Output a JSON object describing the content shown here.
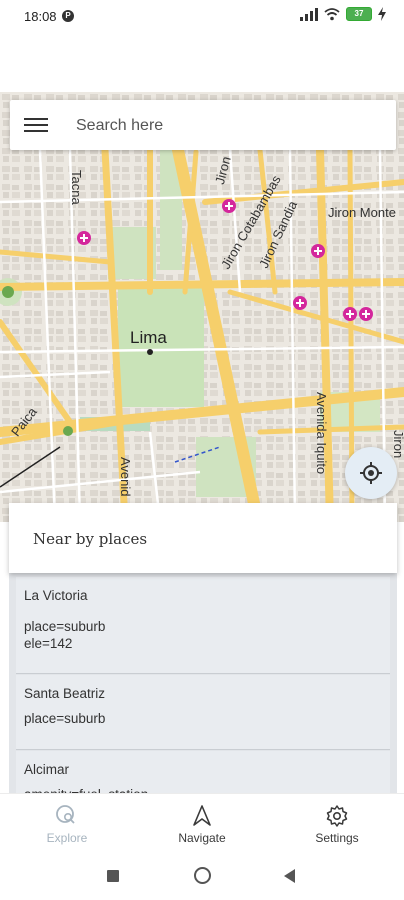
{
  "status_bar": {
    "time": "18:08",
    "battery": "37"
  },
  "search": {
    "placeholder": "Search here"
  },
  "map": {
    "labels": {
      "city": "Lima",
      "street_tacna": "Tacna",
      "street_jiron_1": "Jiron",
      "street_jiron_cotabambas": "Jiron Cotabambas",
      "street_jiron_sandia": "Jiron Sandia",
      "street_jiron_montevideo": "Jiron Monte",
      "street_paica": "Paica",
      "street_avenida_iquitos": "Avenida Iquito",
      "street_avenida": "Avenid",
      "street_jiron_right": "Jiron"
    }
  },
  "nearby": {
    "title": "Near by places",
    "items": [
      {
        "name": "La Victoria",
        "line1": "place=suburb",
        "line2": "ele=142"
      },
      {
        "name": "Santa Beatriz",
        "line1": "place=suburb"
      },
      {
        "name": "Alcimar",
        "line1": "amenity=fuel_station"
      }
    ]
  },
  "bottom_nav": {
    "explore": "Explore",
    "navigate": "Navigate",
    "settings": "Settings"
  },
  "colors": {
    "accent_active": "#a7b4bf",
    "nav_text": "#3a3a3a",
    "road_major": "#f6cf6b",
    "poi": "#d4279c",
    "park": "#b5dba0"
  },
  "icons": {
    "menu": "hamburger-icon",
    "locate": "gps-locate-icon",
    "explore": "map-search-icon",
    "navigate": "navigation-arrow-icon",
    "settings": "gear-icon"
  }
}
